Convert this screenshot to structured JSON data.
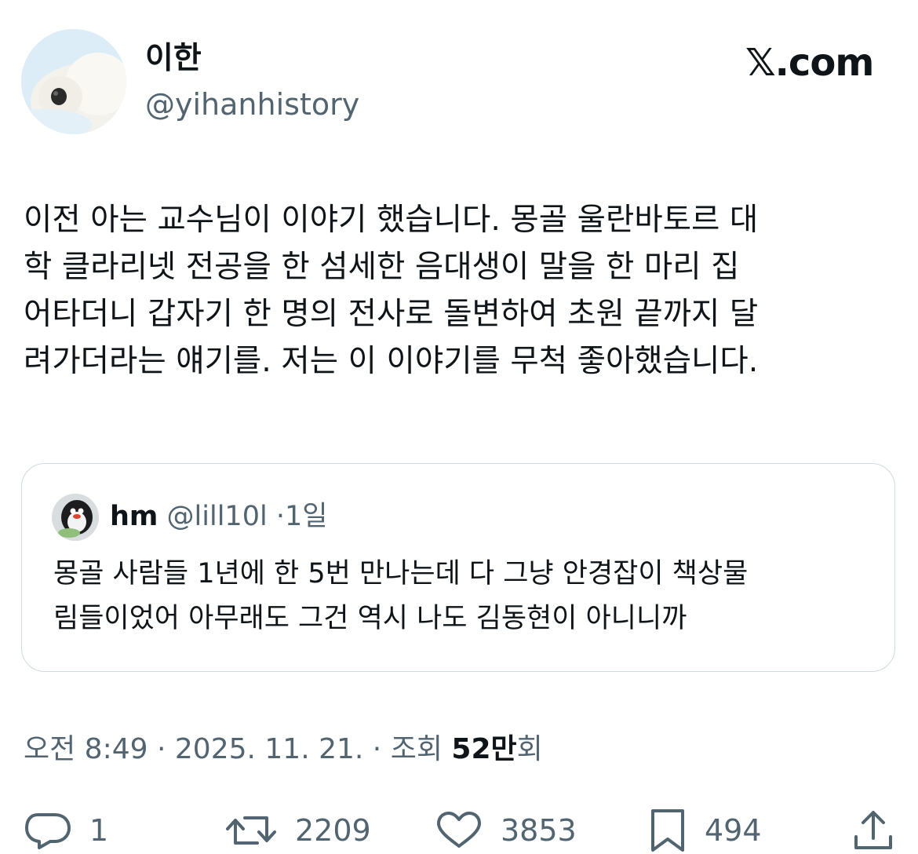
{
  "author": {
    "display_name": "이한",
    "handle": "@yihanhistory"
  },
  "brand": "𝕏.com",
  "tweet": {
    "text": "이전 아는 교수님이 이야기 했습니다. 몽골 울란바토르 대\n학 클라리넷 전공을 한 섬세한 음대생이 말을 한 마리 집\n어타더니 갑자기 한 명의 전사로 돌변하여 초원 끝까지 달\n려가더라는 얘기를. 저는 이 이야기를 무척 좋아했습니다."
  },
  "quote": {
    "name": "hm",
    "handle": "@lill10l",
    "separator": "·",
    "time": "1일",
    "text": "몽골 사람들 1년에 한 5번 만나는데 다 그냥 안경잡이 책상물\n림들이었어 아무래도 그건 역시 나도 김동현이 아니니까"
  },
  "meta": {
    "time": "오전 8:49",
    "separator": "·",
    "date": "2025. 11. 21.",
    "views_label": "조회",
    "views_number": "52만",
    "views_unit": "회"
  },
  "actions": {
    "replies": "1",
    "reposts": "2209",
    "likes": "3853",
    "bookmarks": "494"
  }
}
